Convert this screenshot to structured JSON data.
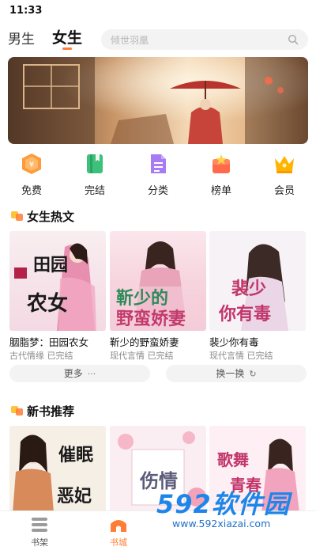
{
  "status": {
    "time": "11:33"
  },
  "top_nav": {
    "tabs": [
      "男生",
      "女生"
    ],
    "active_tab": "女生",
    "search_placeholder": "倾世羽凰"
  },
  "quick_menu": [
    {
      "label": "免费",
      "icon": "free-coin-icon",
      "color": "#ff9a3c"
    },
    {
      "label": "完结",
      "icon": "finished-book-icon",
      "color": "#3cc07a"
    },
    {
      "label": "分类",
      "icon": "category-doc-icon",
      "color": "#a77cf2"
    },
    {
      "label": "榜单",
      "icon": "ranking-icon",
      "color": "#ff6a4a"
    },
    {
      "label": "会员",
      "icon": "vip-crown-icon",
      "color": "#ffb400"
    }
  ],
  "hot_section": {
    "title": "女生热文",
    "books": [
      {
        "title": "胭脂梦：田园农女",
        "category": "古代情缘",
        "status": "已完结",
        "cover_text": "田园农女"
      },
      {
        "title": "靳少的野蛮娇妻",
        "category": "现代言情",
        "status": "已完结",
        "cover_text": "靳少的野蛮娇妻"
      },
      {
        "title": "裴少你有毒",
        "category": "现代言情",
        "status": "已完结",
        "cover_text": "裴少你有毒"
      }
    ],
    "more_label": "更多",
    "more_glyph": "···",
    "refresh_label": "换一换",
    "refresh_glyph": "↻"
  },
  "new_section": {
    "title": "新书推荐",
    "books": [
      {
        "cover_text": "催眠术之恶妃"
      },
      {
        "cover_text": "伤情"
      },
      {
        "cover_text": "歌舞青春"
      }
    ]
  },
  "tab_bar": {
    "items": [
      {
        "label": "书架",
        "icon": "bookshelf-icon"
      },
      {
        "label": "书城",
        "icon": "bookstore-icon"
      }
    ],
    "active": "书城"
  },
  "watermark": {
    "main": "592软件园",
    "sub": "www.592xiazai.com"
  },
  "colors": {
    "accent": "#ff7d34",
    "watermark": "#1e86e8"
  }
}
